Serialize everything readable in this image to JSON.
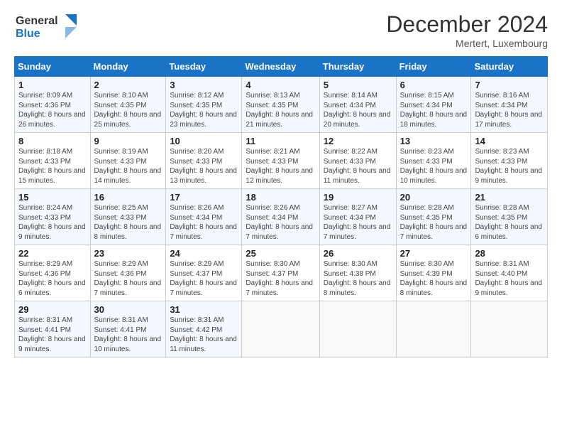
{
  "header": {
    "logo_line1": "General",
    "logo_line2": "Blue",
    "title": "December 2024",
    "subtitle": "Mertert, Luxembourg"
  },
  "days_of_week": [
    "Sunday",
    "Monday",
    "Tuesday",
    "Wednesday",
    "Thursday",
    "Friday",
    "Saturday"
  ],
  "weeks": [
    [
      {
        "day": "1",
        "sunrise": "8:09 AM",
        "sunset": "4:36 PM",
        "daylight": "8 hours and 26 minutes."
      },
      {
        "day": "2",
        "sunrise": "8:10 AM",
        "sunset": "4:35 PM",
        "daylight": "8 hours and 25 minutes."
      },
      {
        "day": "3",
        "sunrise": "8:12 AM",
        "sunset": "4:35 PM",
        "daylight": "8 hours and 23 minutes."
      },
      {
        "day": "4",
        "sunrise": "8:13 AM",
        "sunset": "4:35 PM",
        "daylight": "8 hours and 21 minutes."
      },
      {
        "day": "5",
        "sunrise": "8:14 AM",
        "sunset": "4:34 PM",
        "daylight": "8 hours and 20 minutes."
      },
      {
        "day": "6",
        "sunrise": "8:15 AM",
        "sunset": "4:34 PM",
        "daylight": "8 hours and 18 minutes."
      },
      {
        "day": "7",
        "sunrise": "8:16 AM",
        "sunset": "4:34 PM",
        "daylight": "8 hours and 17 minutes."
      }
    ],
    [
      {
        "day": "8",
        "sunrise": "8:18 AM",
        "sunset": "4:33 PM",
        "daylight": "8 hours and 15 minutes."
      },
      {
        "day": "9",
        "sunrise": "8:19 AM",
        "sunset": "4:33 PM",
        "daylight": "8 hours and 14 minutes."
      },
      {
        "day": "10",
        "sunrise": "8:20 AM",
        "sunset": "4:33 PM",
        "daylight": "8 hours and 13 minutes."
      },
      {
        "day": "11",
        "sunrise": "8:21 AM",
        "sunset": "4:33 PM",
        "daylight": "8 hours and 12 minutes."
      },
      {
        "day": "12",
        "sunrise": "8:22 AM",
        "sunset": "4:33 PM",
        "daylight": "8 hours and 11 minutes."
      },
      {
        "day": "13",
        "sunrise": "8:23 AM",
        "sunset": "4:33 PM",
        "daylight": "8 hours and 10 minutes."
      },
      {
        "day": "14",
        "sunrise": "8:23 AM",
        "sunset": "4:33 PM",
        "daylight": "8 hours and 9 minutes."
      }
    ],
    [
      {
        "day": "15",
        "sunrise": "8:24 AM",
        "sunset": "4:33 PM",
        "daylight": "8 hours and 9 minutes."
      },
      {
        "day": "16",
        "sunrise": "8:25 AM",
        "sunset": "4:33 PM",
        "daylight": "8 hours and 8 minutes."
      },
      {
        "day": "17",
        "sunrise": "8:26 AM",
        "sunset": "4:34 PM",
        "daylight": "8 hours and 7 minutes."
      },
      {
        "day": "18",
        "sunrise": "8:26 AM",
        "sunset": "4:34 PM",
        "daylight": "8 hours and 7 minutes."
      },
      {
        "day": "19",
        "sunrise": "8:27 AM",
        "sunset": "4:34 PM",
        "daylight": "8 hours and 7 minutes."
      },
      {
        "day": "20",
        "sunrise": "8:28 AM",
        "sunset": "4:35 PM",
        "daylight": "8 hours and 7 minutes."
      },
      {
        "day": "21",
        "sunrise": "8:28 AM",
        "sunset": "4:35 PM",
        "daylight": "8 hours and 6 minutes."
      }
    ],
    [
      {
        "day": "22",
        "sunrise": "8:29 AM",
        "sunset": "4:36 PM",
        "daylight": "8 hours and 6 minutes."
      },
      {
        "day": "23",
        "sunrise": "8:29 AM",
        "sunset": "4:36 PM",
        "daylight": "8 hours and 7 minutes."
      },
      {
        "day": "24",
        "sunrise": "8:29 AM",
        "sunset": "4:37 PM",
        "daylight": "8 hours and 7 minutes."
      },
      {
        "day": "25",
        "sunrise": "8:30 AM",
        "sunset": "4:37 PM",
        "daylight": "8 hours and 7 minutes."
      },
      {
        "day": "26",
        "sunrise": "8:30 AM",
        "sunset": "4:38 PM",
        "daylight": "8 hours and 8 minutes."
      },
      {
        "day": "27",
        "sunrise": "8:30 AM",
        "sunset": "4:39 PM",
        "daylight": "8 hours and 8 minutes."
      },
      {
        "day": "28",
        "sunrise": "8:31 AM",
        "sunset": "4:40 PM",
        "daylight": "8 hours and 9 minutes."
      }
    ],
    [
      {
        "day": "29",
        "sunrise": "8:31 AM",
        "sunset": "4:41 PM",
        "daylight": "8 hours and 9 minutes."
      },
      {
        "day": "30",
        "sunrise": "8:31 AM",
        "sunset": "4:41 PM",
        "daylight": "8 hours and 10 minutes."
      },
      {
        "day": "31",
        "sunrise": "8:31 AM",
        "sunset": "4:42 PM",
        "daylight": "8 hours and 11 minutes."
      },
      null,
      null,
      null,
      null
    ]
  ]
}
